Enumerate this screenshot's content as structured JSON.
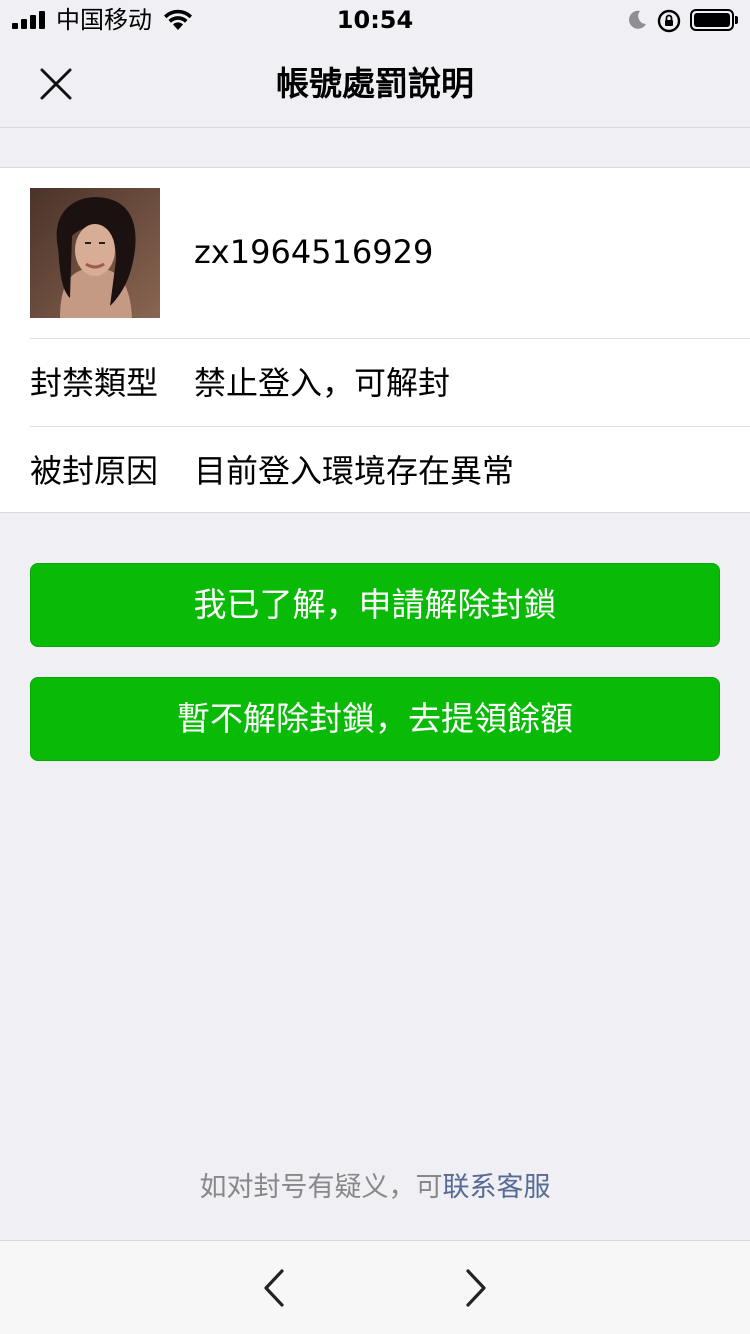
{
  "status_bar": {
    "carrier": "中国移动",
    "time": "10:54"
  },
  "header": {
    "title": "帳號處罰說明"
  },
  "account": {
    "username": "zx1964516929"
  },
  "details": [
    {
      "label": "封禁類型",
      "value": "禁止登入，可解封"
    },
    {
      "label": "被封原因",
      "value": "目前登入環境存在異常"
    }
  ],
  "actions": {
    "primary_label": "我已了解，申請解除封鎖",
    "secondary_label": "暫不解除封鎖，去提領餘額"
  },
  "footer": {
    "note_prefix": "如对封号有疑义，可",
    "note_link": "联系客服"
  },
  "colors": {
    "button_green": "#09bb07",
    "link_blue": "#576b95",
    "background": "#efeff4"
  },
  "icons": {
    "close": "close-icon",
    "back": "chevron-left-icon",
    "forward": "chevron-right-icon"
  }
}
